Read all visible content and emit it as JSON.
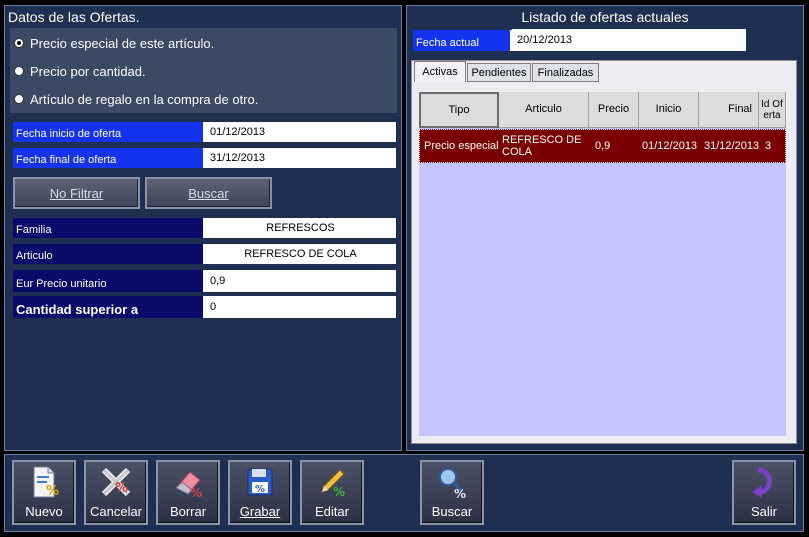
{
  "left_panel": {
    "title": "Datos de las Ofertas.",
    "radios": [
      {
        "label": "Precio especial de este artículo.",
        "selected": true
      },
      {
        "label": "Precio por cantidad.",
        "selected": false
      },
      {
        "label": "Artículo de regalo en la compra de otro.",
        "selected": false
      }
    ],
    "fecha_inicio": {
      "label": "Fecha inicio de oferta",
      "value": "01/12/2013"
    },
    "fecha_final": {
      "label": "Fecha final de oferta",
      "value": "31/12/2013"
    },
    "buttons": {
      "no_filtrar": "No Filtrar",
      "buscar": "Buscar"
    },
    "familia": {
      "label": "Familia",
      "value": "REFRESCOS"
    },
    "articulo": {
      "label": "Articulo",
      "value": "REFRESCO DE COLA"
    },
    "precio_unitario": {
      "label": "Eur Precio unitario",
      "value": "0,9"
    },
    "cantidad_superior": {
      "label": "Cantidad superior a",
      "value": "0"
    }
  },
  "right_panel": {
    "title": "Listado de ofertas actuales",
    "fecha_actual": {
      "label": "Fecha actual",
      "value": "20/12/2013"
    },
    "tabs": [
      {
        "label": "Activas",
        "active": true
      },
      {
        "label": "Pendientes",
        "active": false
      },
      {
        "label": "Finalizadas",
        "active": false
      }
    ],
    "columns": [
      "Tipo",
      "Articulo",
      "Precio",
      "Inicio",
      "Final",
      "Id Oferta"
    ],
    "rows": [
      {
        "tipo": "Precio especial",
        "articulo": "REFRESCO DE COLA",
        "precio": "0,9",
        "inicio": "01/12/2013",
        "final": "31/12/2013",
        "id": "3"
      }
    ]
  },
  "toolbar": {
    "nuevo": "Nuevo",
    "cancelar": "Cancelar",
    "borrar": "Borrar",
    "grabar": "Grabar",
    "editar": "Editar",
    "buscar": "Buscar",
    "salir": "Salir"
  },
  "colors": {
    "panel_bg": "#1f2f52",
    "label_navy": "#0a0a6a",
    "label_blue": "#1433ee",
    "grid_bg": "#c4c4ff",
    "selected_row": "#7a0000"
  }
}
